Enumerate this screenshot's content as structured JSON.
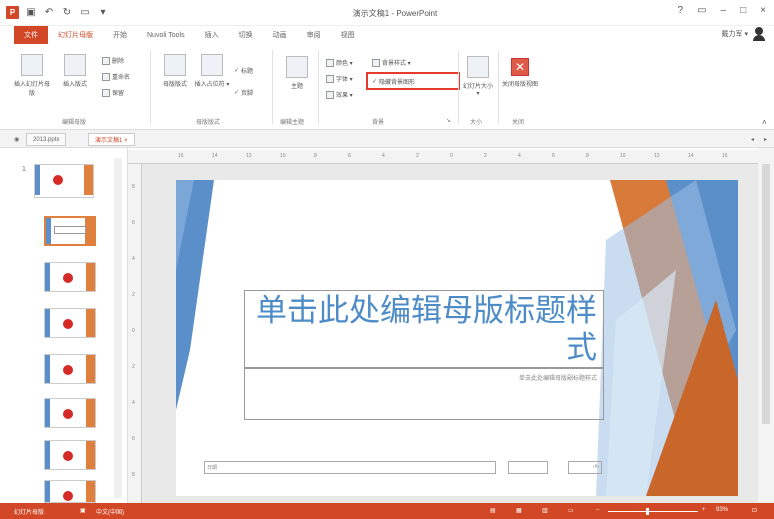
{
  "titlebar": {
    "title": "演示文稿1 - PowerPoint",
    "help": "?",
    "minimize": "–",
    "restore": "□",
    "close": "×"
  },
  "tabs": [
    {
      "label": "文件"
    },
    {
      "label": "幻灯片母版"
    },
    {
      "label": "开始"
    },
    {
      "label": "Nuvoli Tools"
    },
    {
      "label": "插入"
    },
    {
      "label": "切换"
    },
    {
      "label": "动画"
    },
    {
      "label": "审阅"
    },
    {
      "label": "视图"
    }
  ],
  "user": {
    "name": "戴力军 ▾"
  },
  "ribbon": {
    "insert_master": "插入幻灯片母版",
    "insert_layout": "插入版式",
    "delete": "删除",
    "rename": "重命名",
    "preserve": "保留",
    "group_edit_master": "编辑母版",
    "master_layout": "母版版式",
    "insert_placeholder": "插入占位符 ▾",
    "title_chk": "标题",
    "footer_chk": "页脚",
    "group_master_layout": "母版版式",
    "theme": "主题",
    "group_edit_theme": "编辑主题",
    "colors": "颜色 ▾",
    "fonts": "字体 ▾",
    "effects": "效果 ▾",
    "bg_styles": "背景样式 ▾",
    "hide_bg": "隐藏背景图形",
    "group_background": "背景",
    "slide_size": "幻灯片大小 ▾",
    "group_size": "大小",
    "close_master": "关闭母版视图",
    "group_close": "关闭"
  },
  "doctabs": [
    {
      "label": "2013.pptx"
    },
    {
      "label": "演示文稿1 ×"
    }
  ],
  "thumbnails": {
    "first_number": "1"
  },
  "ruler": {
    "h_ticks": [
      "16",
      "14",
      "12",
      "10",
      "8",
      "6",
      "4",
      "2",
      "0",
      "2",
      "4",
      "6",
      "8",
      "10",
      "12",
      "14",
      "16"
    ],
    "v_ticks": [
      "8",
      "6",
      "4",
      "2",
      "0",
      "2",
      "4",
      "6",
      "8"
    ]
  },
  "slide": {
    "title": "单击此处编辑母版标题样式",
    "subtitle": "单击此处编辑母版副标题样式",
    "footer_date": "日期",
    "footer_page": "‹#›"
  },
  "statusbar": {
    "view": "幻灯片母版",
    "lang": "中文(中国)",
    "zoom": "93%"
  },
  "colors": {
    "accent": "#d24726",
    "slide_blue": "#4e8cc7",
    "slide_orange": "#d87a3a",
    "highlight_box": "#e43b2d"
  }
}
